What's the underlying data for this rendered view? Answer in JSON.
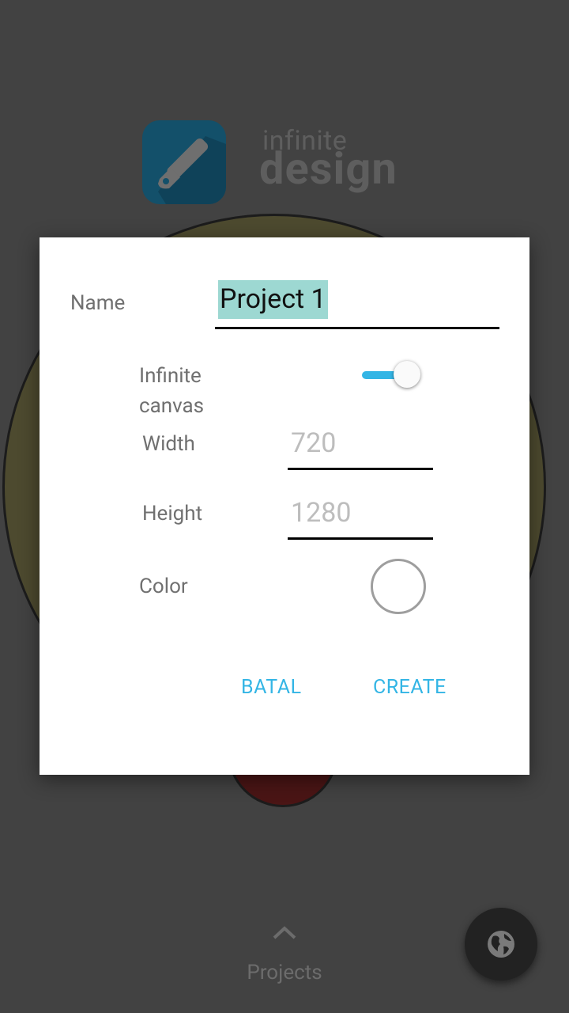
{
  "background": {
    "logo": {
      "line1": "infinite",
      "line2": "design"
    },
    "projects_label": "Projects",
    "icons": {
      "app": "pen-nib-icon",
      "expand": "chevron-up-icon",
      "fab": "globe-icon"
    }
  },
  "dialog": {
    "name_label": "Name",
    "name_value": "Project 1",
    "infinite_canvas_label_line1": "Infinite",
    "infinite_canvas_label_line2": "canvas",
    "infinite_canvas_on": true,
    "width_label": "Width",
    "width_hint": "720",
    "height_label": "Height",
    "height_hint": "1280",
    "color_label": "Color",
    "color_value": "#ffffff",
    "cancel_label": "BATAL",
    "create_label": "CREATE"
  },
  "colors": {
    "accent": "#33b5e5",
    "selection": "#9dd8d2",
    "scrim": "#424242"
  }
}
